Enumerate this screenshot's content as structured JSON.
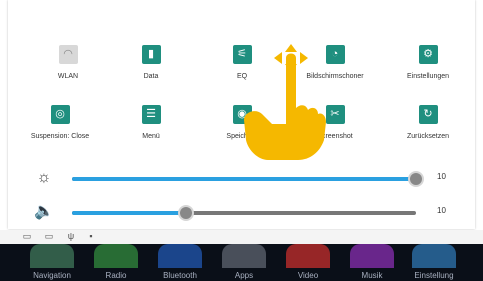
{
  "tiles": [
    {
      "label": "WLAN",
      "icon": "wifi-icon",
      "glyph": "◠",
      "style": "gray"
    },
    {
      "label": "Data",
      "icon": "bar-chart-icon",
      "glyph": "▮",
      "style": "teal"
    },
    {
      "label": "EQ",
      "icon": "equalizer-icon",
      "glyph": "⚟",
      "style": "teal"
    },
    {
      "label": "Bildschirmschoner",
      "icon": "timer-icon",
      "glyph": "◔",
      "style": "teal"
    },
    {
      "label": "Einstellungen",
      "icon": "gear-icon",
      "glyph": "⚙",
      "style": "teal"
    },
    {
      "label": "Suspension: Close",
      "icon": "suspension-icon",
      "glyph": "◎",
      "style": "teal"
    },
    {
      "label": "Menü",
      "icon": "menu-icon",
      "glyph": "☰",
      "style": "teal"
    },
    {
      "label": "Speicher l",
      "icon": "storage-icon",
      "glyph": "◉",
      "style": "teal"
    },
    {
      "label": "Screenshot",
      "icon": "scissors-icon",
      "glyph": "✂",
      "style": "teal"
    },
    {
      "label": "Zurücksetzen",
      "icon": "refresh-icon",
      "glyph": "↻",
      "style": "teal"
    }
  ],
  "sliders": [
    {
      "icon": "brightness-icon",
      "glyph": "☼",
      "value": "10",
      "level": 1.0
    },
    {
      "icon": "volume-icon",
      "glyph": "🔈",
      "value": "10",
      "level": 0.33
    }
  ],
  "dock": [
    {
      "label": "Navigation",
      "color": "#3a6b52"
    },
    {
      "label": "Radio",
      "color": "#2e7d3a"
    },
    {
      "label": "Bluetooth",
      "color": "#1f4fa0"
    },
    {
      "label": "Apps",
      "color": "#555a66"
    },
    {
      "label": "Video",
      "color": "#b02a2a"
    },
    {
      "label": "Musik",
      "color": "#7a2aa0"
    },
    {
      "label": "Einstellung",
      "color": "#2a6aa0"
    }
  ],
  "colors": {
    "accent": "#1f8f7f",
    "slider_fill": "#2aa0e0",
    "hand": "#f5b800"
  }
}
